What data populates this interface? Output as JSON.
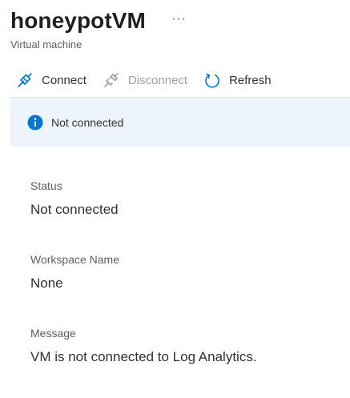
{
  "header": {
    "title": "honeypotVM",
    "more": "···",
    "subtitle": "Virtual machine"
  },
  "toolbar": {
    "connect_label": "Connect",
    "disconnect_label": "Disconnect",
    "refresh_label": "Refresh",
    "icons": {
      "connect": "plug-connect-icon",
      "disconnect": "plug-disconnect-icon",
      "refresh": "refresh-icon"
    }
  },
  "info_bar": {
    "icon": "info-icon",
    "text": "Not connected",
    "background": "#eef4fb",
    "icon_color": "#0078d4"
  },
  "fields": [
    {
      "label": "Status",
      "value": "Not connected"
    },
    {
      "label": "Workspace Name",
      "value": "None"
    },
    {
      "label": "Message",
      "value": "VM is not connected to Log Analytics."
    }
  ],
  "colors": {
    "accent": "#0078d4",
    "disabled": "#a19f9d",
    "text": "#323130",
    "secondary_text": "#605e5c"
  }
}
